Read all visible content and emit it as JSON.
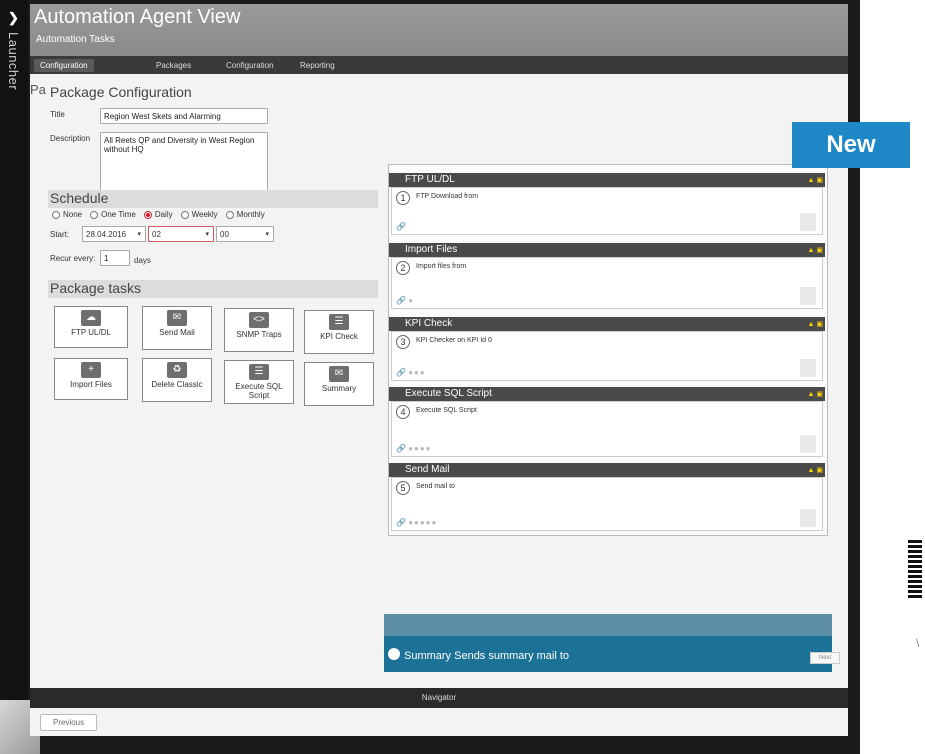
{
  "launcher": {
    "label": "Launcher"
  },
  "window": {
    "title": "Automation Agent View",
    "subtitle": "Automation Tasks"
  },
  "badge": {
    "label": "New"
  },
  "tabs": [
    {
      "label": "Configuration"
    },
    {
      "label": "Packages"
    },
    {
      "label": "Configuration"
    },
    {
      "label": "Reporting"
    }
  ],
  "package_config": {
    "heading": "Package Configuration",
    "title_label": "Title",
    "title_value": "Region West Skets and Alarming",
    "description_label": "Description",
    "description_value": "All Reets QP and Diversity in West Region without HQ"
  },
  "schedule": {
    "heading": "Schedule",
    "options": [
      "None",
      "One Time",
      "Daily",
      "Weekly",
      "Monthly"
    ],
    "selected": "Daily",
    "start_label": "Start:",
    "start_date": "28.04.2016",
    "hour": "02",
    "minute": "00",
    "recur_label": "Recur every:",
    "recur_value": "1",
    "recur_unit": "days"
  },
  "package_tasks": {
    "heading": "Package tasks",
    "buttons": [
      {
        "label": "FTP UL/DL",
        "icon": "cloud-upload-icon"
      },
      {
        "label": "Send Mail",
        "icon": "mail-icon"
      },
      {
        "label": "SNMP Traps",
        "icon": "code-icon"
      },
      {
        "label": "KPI Check",
        "icon": "document-icon"
      },
      {
        "label": "Import Files",
        "icon": "folder-plus-icon"
      },
      {
        "label": "Delete Classic",
        "icon": "recycle-icon"
      },
      {
        "label": "Execute SQL Script",
        "icon": "script-icon"
      },
      {
        "label": "Summary",
        "icon": "summary-mail-icon"
      }
    ]
  },
  "steps": [
    {
      "header": "FTP UL/DL",
      "num": "1",
      "text": "FTP Download from"
    },
    {
      "header": "Import Files",
      "num": "2",
      "text": "Import files from"
    },
    {
      "header": "KPI Check",
      "num": "3",
      "text": "KPI Checker on KPI Id 0"
    },
    {
      "header": "Execute SQL Script",
      "num": "4",
      "text": "Execute SQL Script"
    },
    {
      "header": "Send Mail",
      "num": "5",
      "text": "Send mail to"
    }
  ],
  "summary": {
    "text": "Summary Sends summary mail to"
  },
  "navigator": {
    "label": "Navigator"
  },
  "footer": {
    "previous": "Previous",
    "next": "Next"
  }
}
